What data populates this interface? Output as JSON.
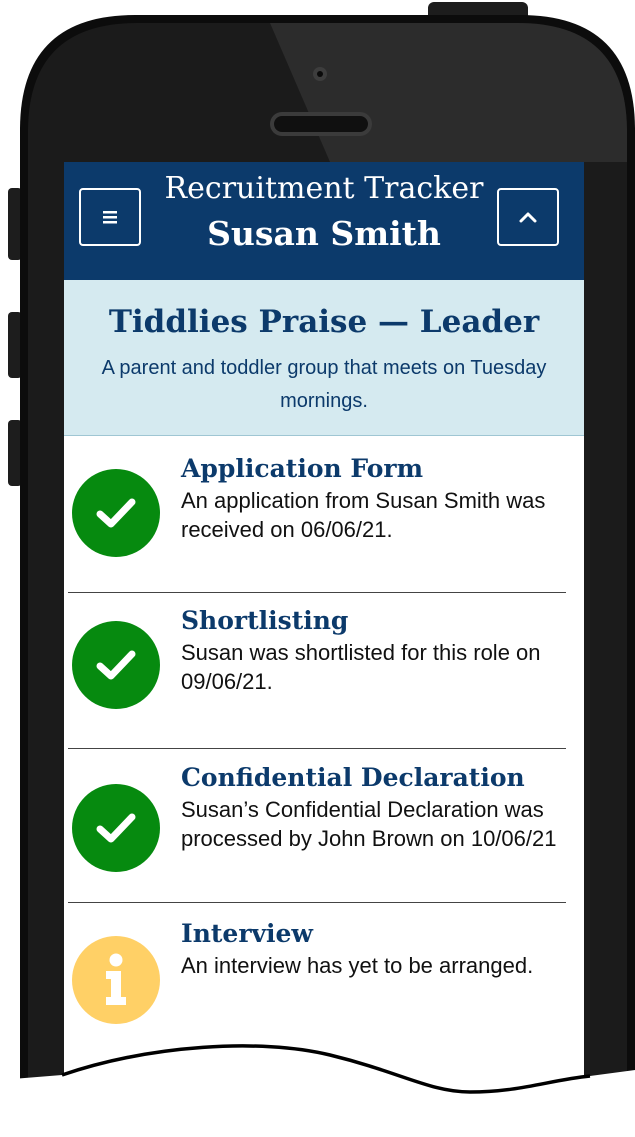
{
  "app": {
    "subtitle": "Recruitment Tracker",
    "title": "Susan Smith"
  },
  "header": {
    "menu_icon": "hamburger-menu-icon",
    "collapse_icon": "chevron-up-icon"
  },
  "role": {
    "title": "Tiddlies Praise — Leader",
    "description": "A parent and toddler group that meets on Tuesday mornings."
  },
  "steps": [
    {
      "title": "Application Form",
      "text": "An application from Susan Smith was received on 06/06/21.",
      "status": "complete",
      "icon": "checkmark-icon"
    },
    {
      "title": "Shortlisting",
      "text": "Susan was shortlisted for this role on 09/06/21.",
      "status": "complete",
      "icon": "checkmark-icon"
    },
    {
      "title": "Confidential Declaration",
      "text": "Susan’s Confidential Declaration was processed by John Brown on 10/06/21",
      "status": "complete",
      "icon": "checkmark-icon"
    },
    {
      "title": "Interview",
      "text": "An interview has yet to be arranged.",
      "status": "pending",
      "icon": "info-icon"
    }
  ],
  "colors": {
    "header_bg": "#0c3a6b",
    "role_bg": "#d5eaf0",
    "complete": "#068a0f",
    "pending": "#ffd066"
  }
}
